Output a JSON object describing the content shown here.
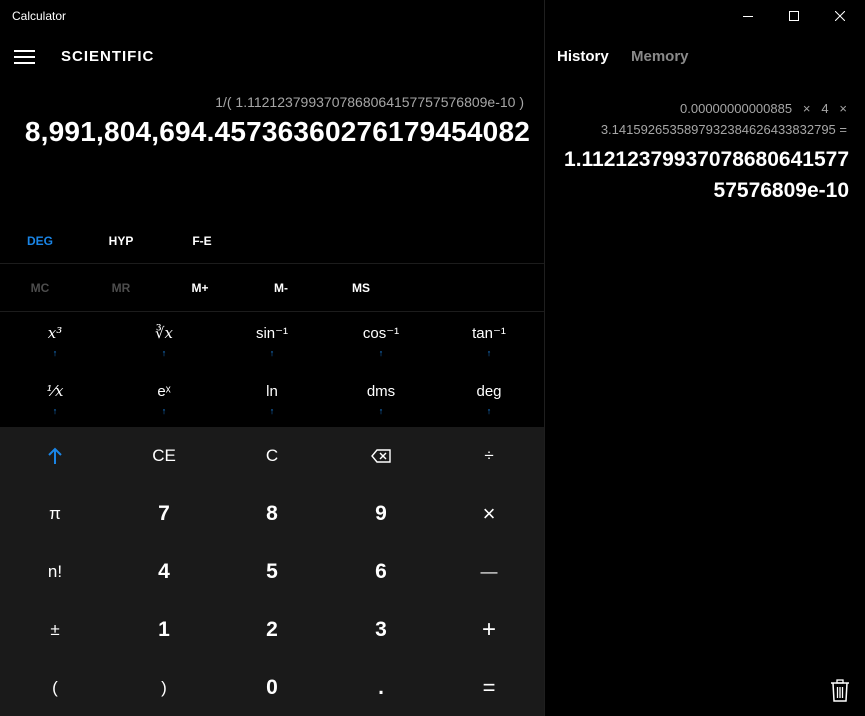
{
  "window": {
    "title": "Calculator"
  },
  "calc": {
    "mode": "SCIENTIFIC",
    "expression": "1/( 1.1121237993707868064157757576809e-10 )",
    "result": "8,991,804,694.4573636027617945408​2",
    "angle_row": {
      "deg": "DEG",
      "hyp": "HYP",
      "fe": "F-E"
    },
    "memory_row": {
      "mc": "MC",
      "mr": "MR",
      "mplus": "M+",
      "mminus": "M-",
      "ms": "MS"
    },
    "sci": {
      "cube": "x³",
      "cube_root": "∛x",
      "asin": "sin⁻¹",
      "acos": "cos⁻¹",
      "atan": "tan⁻¹",
      "recip": "¹⁄x",
      "exp": "eˣ",
      "ln": "ln",
      "dms": "dms",
      "deg": "deg",
      "shift": "↑"
    },
    "keys": {
      "shift": "↑",
      "ce": "CE",
      "c": "C",
      "back": "⌫",
      "div": "÷",
      "pi": "π",
      "seven": "7",
      "eight": "8",
      "nine": "9",
      "mul": "×",
      "fact": "n!",
      "four": "4",
      "five": "5",
      "six": "6",
      "minus": "—",
      "negate": "±",
      "one": "1",
      "two": "2",
      "three": "3",
      "plus": "+",
      "lparen": "(",
      "rparen": ")",
      "zero": "0",
      "dot": ".",
      "equals": "="
    }
  },
  "history": {
    "tab_history": "History",
    "tab_memory": "Memory",
    "entries": [
      {
        "expression_line1": "0.00000000000885   ×   4   ×",
        "expression_line2": "3.1415926535897932384626433832795 =",
        "result": "1.11212379937078680641577575768​09e-10"
      }
    ]
  },
  "colors": {
    "accent": "#1a85e6",
    "keypad_bg": "#1a1a1a",
    "background": "#000000"
  }
}
